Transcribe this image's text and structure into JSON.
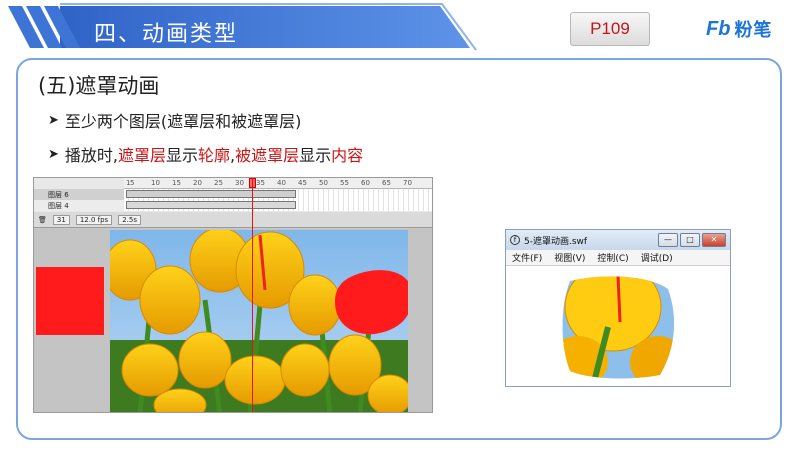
{
  "header": {
    "title": "四、动画类型",
    "page_number": "P109",
    "logo_mark": "Fb",
    "logo_text": "粉笔"
  },
  "content": {
    "section_title": "(五)遮罩动画",
    "bullet1": "至少两个图层(遮罩层和被遮罩层)",
    "bullet2": {
      "part1": "播放时,",
      "part2": "遮罩层",
      "part3": "显示",
      "part4": "轮廓",
      "part5": ",",
      "part6": "被遮罩层",
      "part7": "显示",
      "part8": "内容"
    }
  },
  "editor": {
    "ruler_ticks": [
      "1",
      "5",
      "10",
      "15",
      "20",
      "25",
      "30",
      "35",
      "40",
      "45",
      "50",
      "55",
      "60",
      "65",
      "70"
    ],
    "layer1": "图层 6",
    "layer2": "图层 4",
    "frame": "31",
    "fps": "12.0 fps",
    "time": "2.5s"
  },
  "swf_window": {
    "title": "5-遮罩动画.swf",
    "menu": [
      "文件(F)",
      "视图(V)",
      "控制(C)",
      "调试(D)"
    ],
    "minimize": "—",
    "maximize": "□",
    "close": "✕"
  },
  "colors": {
    "banner_blue": "#3e74d6",
    "frame_border": "#7aa6e0",
    "accent_red": "#cc1414",
    "mask_red": "#ff1b1b"
  }
}
